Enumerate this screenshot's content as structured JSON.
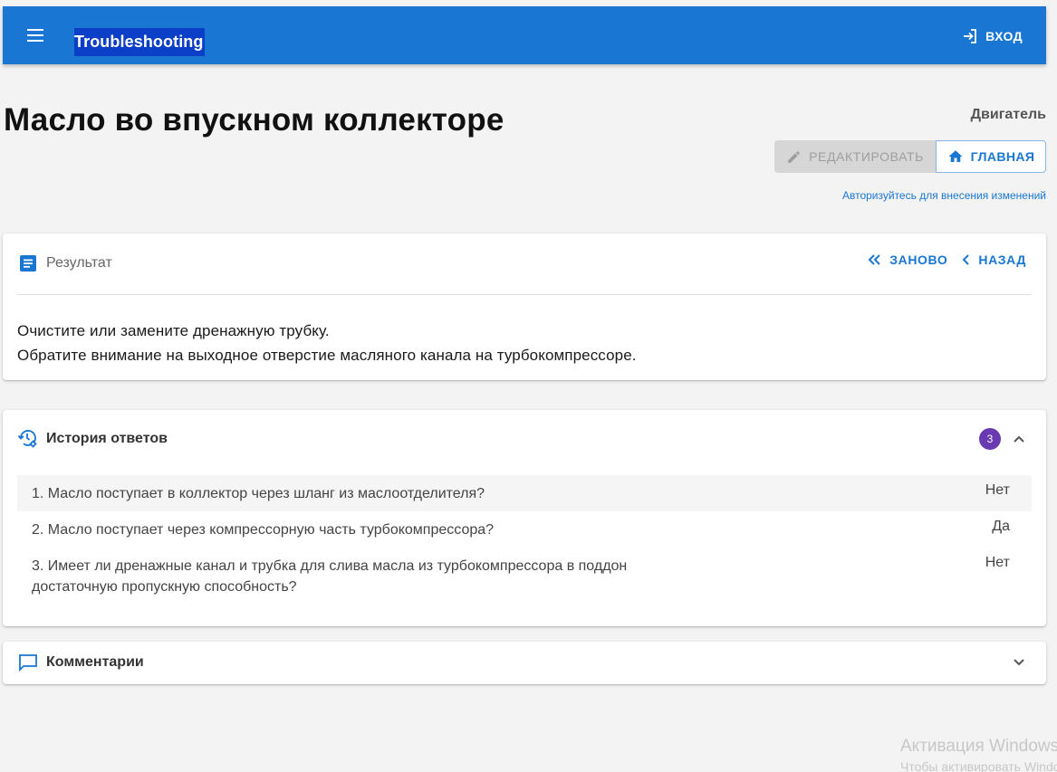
{
  "appbar": {
    "title": "Troubleshooting",
    "login_label": "ВХОД",
    "color": "#1976d2"
  },
  "page": {
    "title": "Масло во впускном коллекторе",
    "category": "Двигатель",
    "edit_label": "РЕДАКТИРОВАТЬ",
    "home_label": "ГЛАВНАЯ",
    "auth_hint": "Авторизуйтесь для внесения изменений"
  },
  "result": {
    "label": "Результат",
    "restart_label": "ЗАНОВО",
    "back_label": "НАЗАД",
    "line1": "Очистите или замените дренажную трубку.",
    "line2": "Обратите внимание на выходное отверстие масляного канала на турбокомпрессоре."
  },
  "history": {
    "label": "История ответов",
    "count": "3",
    "items": [
      {
        "question": "1. Масло поступает в коллектор через шланг из маслоотделителя?",
        "answer": "Нет"
      },
      {
        "question": "2. Масло поступает через компрессорную часть турбокомпрессора?",
        "answer": "Да"
      },
      {
        "question": "3. Имеет ли дренажные канал и трубка для слива масла из турбокомпрессора в поддон достаточную пропускную способность?",
        "answer": "Нет"
      }
    ]
  },
  "comments": {
    "label": "Комментарии"
  },
  "watermark": {
    "line1": "Активация Windows",
    "line2": "Чтобы активировать Windows"
  },
  "icons": {
    "menu": "menu-icon",
    "login": "login-icon",
    "edit": "pencil-icon",
    "home": "home-icon",
    "result": "document-icon",
    "restart": "double-chevron-left-icon",
    "back": "chevron-left-icon",
    "history": "history-settings-icon",
    "collapse": "chevron-up-icon",
    "comments": "comment-icon",
    "expand": "chevron-down-icon"
  }
}
